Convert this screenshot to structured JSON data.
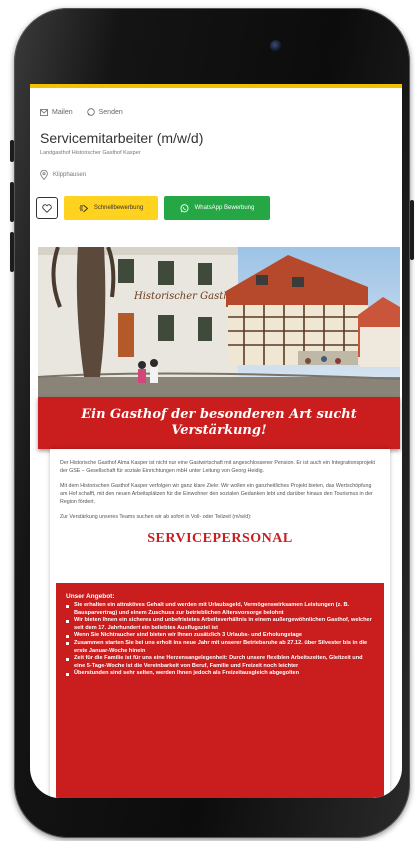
{
  "actions": {
    "mail": "Mailen",
    "share": "Senden"
  },
  "job": {
    "title": "Servicemitarbeiter (m/w/d)",
    "company": "Landgasthof Historischer Gasthof Kasper",
    "location": "Klipphausen"
  },
  "buttons": {
    "quick_apply": "Schnellbewerbung",
    "whatsapp_apply": "WhatsApp Bewerbung"
  },
  "ad": {
    "photo_sign": "Historischer Gasthof",
    "banner_line1": "Ein Gasthof der besonderen Art sucht",
    "banner_line2": "Verstärkung!",
    "para1": "Der Historische Gasthof Alma Kasper ist nicht nur eine Gastwirtschaft mit angeschlossener Pension. Er ist auch ein Integrationsprojekt der GSE – Gesellschaft für soziale Einrichtungen mbH unter Leitung von Georg Heidig.",
    "para2": "Mit dem Historischen Gasthof Kasper verfolgen wir ganz klare Ziele: Wir wollen ein ganzheitliches Projekt bieten, das Wertschöpfung am Hof schafft, mit den neuen Arbeitsplätzen für die Einwohner den sozialen Gedanken lebt und darüber hinaus den Tourismus in der Region fördert.",
    "para3": "Zur Verstärkung unseres Teams suchen wir ab sofort in Voll- oder Teilzeit (m/w/d):",
    "heading": "SERVICEPERSONAL",
    "offer_title": "Unser Angebot:",
    "offer_items": [
      "Sie erhalten ein attraktives Gehalt und werden mit Urlaubsgeld, Vermögenswirksamen Leistungen (z. B. Bausparvertrag) und einem Zuschuss zur betrieblichen Altersvorsorge belohnt",
      "Wir bieten Ihnen ein sicheres und unbefristetes Arbeitsverhältnis in einem außergewöhnlichen Gasthof, welcher seit dem 17. Jahrhundert ein beliebtes Ausflugsziel ist",
      "Wenn Sie Nichtraucher sind bieten wir Ihnen zusätzlich 3 Urlaubs- und Erholungstage",
      "Zusammen starten Sie bei uns erholt ins neue Jahr mit unserer Betriebsruhe ab 27.12. über Silvester bis in die erste Januar-Woche hinein",
      "Zeit für die Familie ist für uns eine Herzensangelegenheit: Durch unsere flexiblen Arbeitszeiten, Gleitzeit und eine 5-Tage-Woche ist die Vereinbarkeit von Beruf, Familie und Freizeit noch leichter",
      "Überstunden sind sehr selten, werden Ihnen jedoch als Freizeitausgleich abgegolten"
    ]
  },
  "colors": {
    "accent_yellow": "#ffd21f",
    "whatsapp_green": "#25a745",
    "ad_red": "#c91d1e"
  }
}
